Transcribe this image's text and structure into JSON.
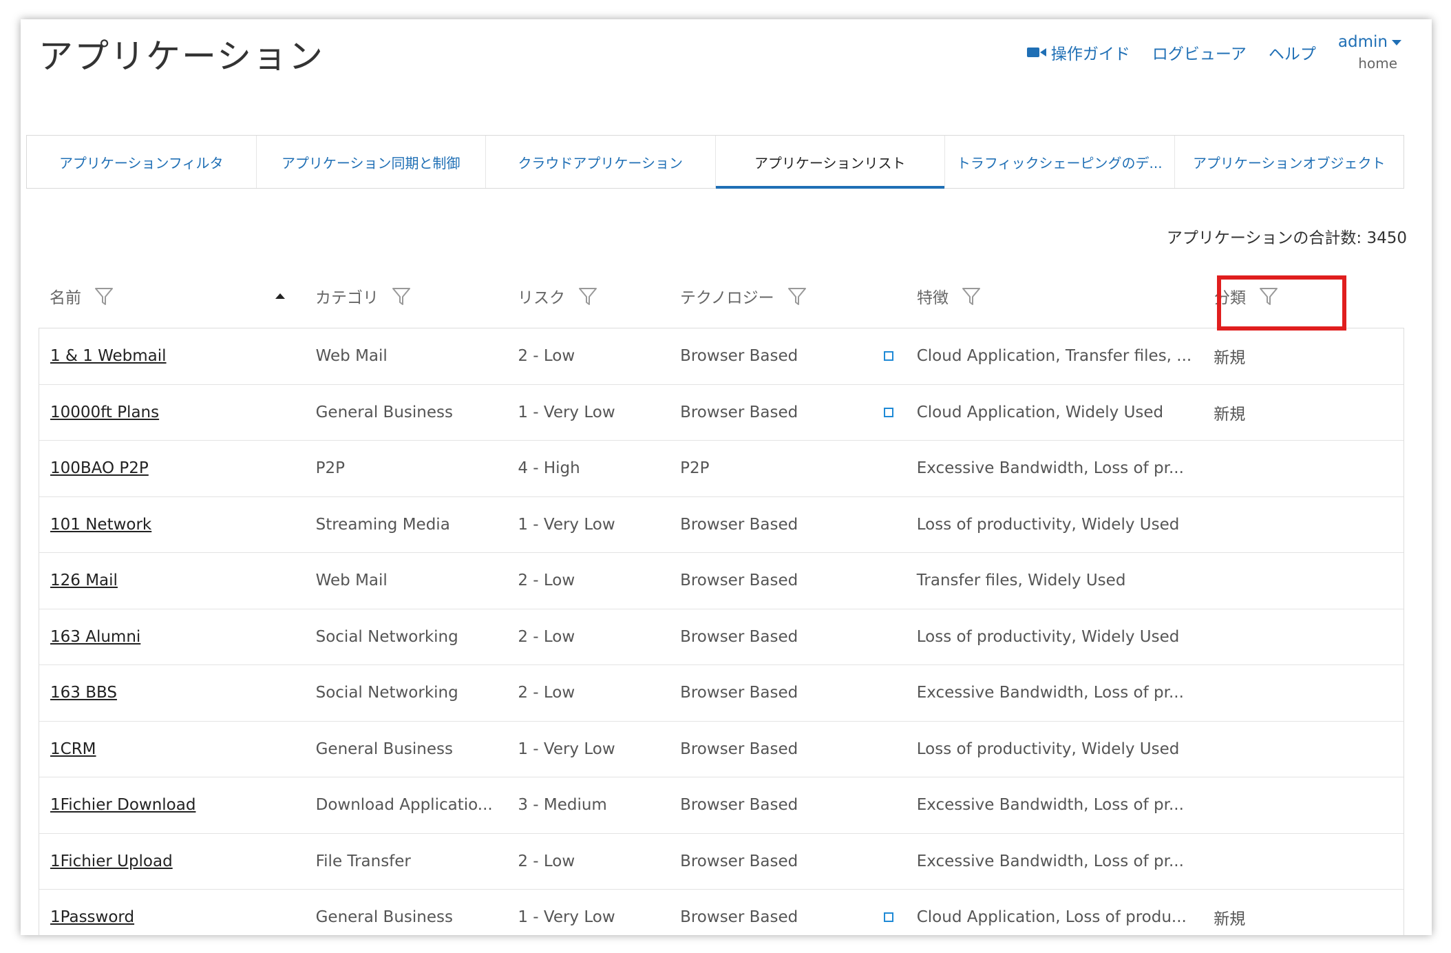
{
  "page": {
    "title": "アプリケーション"
  },
  "header_links": {
    "guide": "操作ガイド",
    "log_viewer": "ログビューア",
    "help": "ヘルプ",
    "admin": "admin",
    "admin_sub": "home",
    "guide_icon": "video-camera-icon"
  },
  "tabs": [
    {
      "label": "アプリケーションフィルタ",
      "active": false
    },
    {
      "label": "アプリケーション同期と制御",
      "active": false
    },
    {
      "label": "クラウドアプリケーション",
      "active": false
    },
    {
      "label": "アプリケーションリスト",
      "active": true
    },
    {
      "label": "トラフィックシェーピングのデ...",
      "active": false
    },
    {
      "label": "アプリケーションオブジェクト",
      "active": false
    }
  ],
  "total_label": "アプリケーションの合計数: 3450",
  "columns": {
    "name": "名前",
    "category": "カテゴリ",
    "risk": "リスク",
    "technology": "テクノロジー",
    "features": "特徴",
    "classification": "分類"
  },
  "colors": {
    "accent": "#1f6fb5",
    "highlight": "#e01e1e"
  },
  "rows": [
    {
      "name": "1 & 1 Webmail",
      "category": "Web Mail",
      "risk": "2 - Low",
      "technology": "Browser Based",
      "cloud_icon": true,
      "features": "Cloud Application, Transfer files, ...",
      "classification": "新規"
    },
    {
      "name": "10000ft Plans",
      "category": "General Business",
      "risk": "1 - Very Low",
      "technology": "Browser Based",
      "cloud_icon": true,
      "features": "Cloud Application, Widely Used",
      "classification": "新規"
    },
    {
      "name": "100BAO P2P",
      "category": "P2P",
      "risk": "4 - High",
      "technology": "P2P",
      "cloud_icon": false,
      "features": "Excessive Bandwidth, Loss of pr...",
      "classification": ""
    },
    {
      "name": "101 Network",
      "category": "Streaming Media",
      "risk": "1 - Very Low",
      "technology": "Browser Based",
      "cloud_icon": false,
      "features": "Loss of productivity, Widely Used",
      "classification": ""
    },
    {
      "name": "126 Mail",
      "category": "Web Mail",
      "risk": "2 - Low",
      "technology": "Browser Based",
      "cloud_icon": false,
      "features": "Transfer files, Widely Used",
      "classification": ""
    },
    {
      "name": "163 Alumni",
      "category": "Social Networking",
      "risk": "2 - Low",
      "technology": "Browser Based",
      "cloud_icon": false,
      "features": "Loss of productivity, Widely Used",
      "classification": ""
    },
    {
      "name": "163 BBS",
      "category": "Social Networking",
      "risk": "2 - Low",
      "technology": "Browser Based",
      "cloud_icon": false,
      "features": "Excessive Bandwidth, Loss of pr...",
      "classification": ""
    },
    {
      "name": "1CRM",
      "category": "General Business",
      "risk": "1 - Very Low",
      "technology": "Browser Based",
      "cloud_icon": false,
      "features": "Loss of productivity, Widely Used",
      "classification": ""
    },
    {
      "name": "1Fichier Download",
      "category": "Download Applicatio...",
      "risk": "3 - Medium",
      "technology": "Browser Based",
      "cloud_icon": false,
      "features": "Excessive Bandwidth, Loss of pr...",
      "classification": ""
    },
    {
      "name": "1Fichier Upload",
      "category": "File Transfer",
      "risk": "2 - Low",
      "technology": "Browser Based",
      "cloud_icon": false,
      "features": "Excessive Bandwidth, Loss of pr...",
      "classification": ""
    },
    {
      "name": "1Password",
      "category": "General Business",
      "risk": "1 - Very Low",
      "technology": "Browser Based",
      "cloud_icon": true,
      "features": "Cloud Application, Loss of produ...",
      "classification": "新規"
    }
  ]
}
